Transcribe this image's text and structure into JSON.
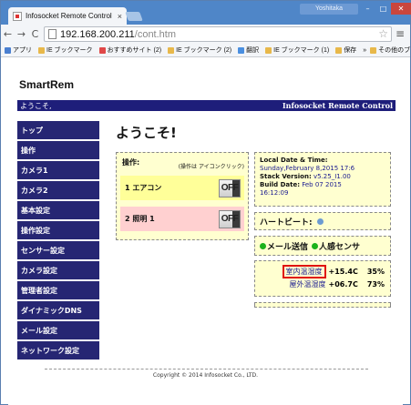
{
  "browser": {
    "tab_title": "Infosocket Remote Control",
    "tab_close": "×",
    "user_badge": "Yoshitaka",
    "win_min": "–",
    "win_max": "□",
    "win_close": "✕",
    "back": "←",
    "forward": "→",
    "reload": "C",
    "url_host": "192.168.200.211",
    "url_path": "/cont.htm",
    "star": "☆",
    "menu": "≡",
    "bookmarks": [
      {
        "label": "アプリ",
        "color": "#4a7fd0"
      },
      {
        "label": "IE ブックマーク",
        "color": "#e8b84a"
      },
      {
        "label": "おすすめサイト (2)",
        "color": "#e04848"
      },
      {
        "label": "IE ブックマーク (2)",
        "color": "#e8b84a"
      },
      {
        "label": "翻訳",
        "color": "#4a8fe0"
      },
      {
        "label": "IE ブックマーク (1)",
        "color": "#e8b84a"
      },
      {
        "label": "保存",
        "color": "#e8b84a"
      }
    ],
    "bookmarks_more": "»",
    "other_bookmarks": "その他のブックマーク"
  },
  "site": {
    "title": "SmartRem",
    "welcome_bar": "ようこそ,",
    "brand_bar": "Infosocket Remote Control",
    "heading": "ようこそ!"
  },
  "sidebar": {
    "items": [
      {
        "label": "トップ"
      },
      {
        "label": "操作"
      },
      {
        "label": "カメラ1"
      },
      {
        "label": "カメラ2"
      },
      {
        "label": "基本設定"
      },
      {
        "label": "操作設定"
      },
      {
        "label": "センサー設定"
      },
      {
        "label": "カメラ設定"
      },
      {
        "label": "管理者設定"
      },
      {
        "label": "ダイナミックDNS"
      },
      {
        "label": "メール設定"
      },
      {
        "label": "ネットワーク設定"
      }
    ]
  },
  "operation": {
    "label": "操作:",
    "hint": "(操作は アイコンクリック)",
    "rows": [
      {
        "name": "1 エアコン",
        "state": "OFF"
      },
      {
        "name": "2 照明 1",
        "state": "OFF"
      }
    ]
  },
  "info": {
    "date_label": "Local Date & Time:",
    "date_value": "Sunday,February 8,2015 17:6",
    "stack_label": "Stack Version:",
    "stack_value": "v5.25_I1.00",
    "build_label": "Build Date:",
    "build_value": "Feb 07 2015",
    "build_time": "16:12:09"
  },
  "heartbeat": {
    "label": "ハートビート:"
  },
  "status": {
    "mail": "メール送信",
    "motion": "人感センサ"
  },
  "sensors": [
    {
      "label": "室内温湿度",
      "temp": "+15.4C",
      "humidity": "35%"
    },
    {
      "label": "屋外温湿度",
      "temp": "+06.7C",
      "humidity": "73%"
    }
  ],
  "footer": {
    "copyright": "Copyright © 2014 Infosocket Co., LTD."
  }
}
